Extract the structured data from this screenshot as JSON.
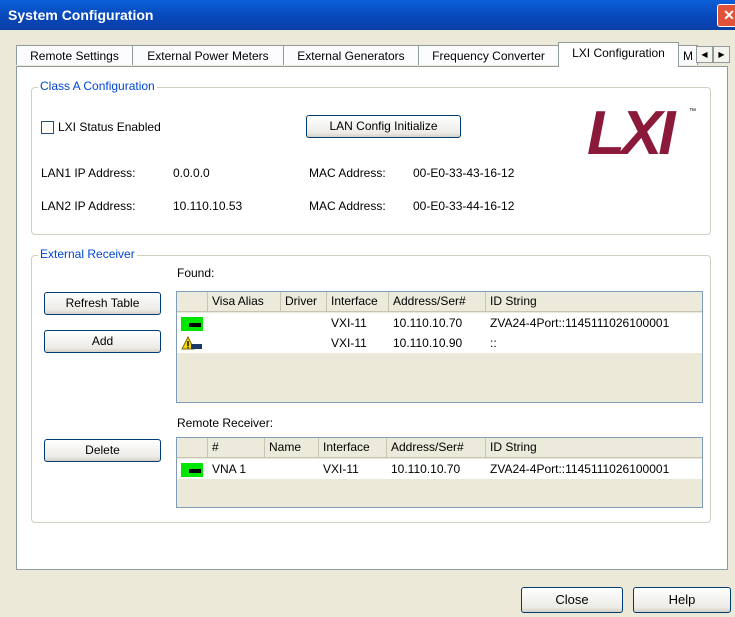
{
  "window": {
    "title": "System Configuration",
    "close_glyph": "✕"
  },
  "tabs": [
    {
      "label": "Remote Settings"
    },
    {
      "label": "External Power Meters"
    },
    {
      "label": "External Generators"
    },
    {
      "label": "Frequency Converter"
    },
    {
      "label": "LXI Configuration",
      "active": true
    },
    {
      "label": "M"
    }
  ],
  "tab_arrows": {
    "left": "◀",
    "right": "▶"
  },
  "class_a": {
    "title": "Class A Configuration",
    "lxi_status_label": "LXI Status Enabled",
    "lxi_status_checked": false,
    "lan_init_button": "LAN Config Initialize",
    "logo_text": "LXI",
    "logo_tm": "™",
    "lan1": {
      "label": "LAN1  IP Address:",
      "ip": "0.0.0.0",
      "mac_label": "MAC Address:",
      "mac": "00-E0-33-43-16-12"
    },
    "lan2": {
      "label": "LAN2  IP Address:",
      "ip": "10.110.10.53",
      "mac_label": "MAC Address:",
      "mac": "00-E0-33-44-16-12"
    }
  },
  "external_receiver": {
    "title": "External Receiver",
    "found_label": "Found:",
    "refresh_button": "Refresh Table",
    "add_button": "Add",
    "delete_button": "Delete",
    "found_table": {
      "columns": [
        "",
        "Visa Alias",
        "Driver",
        "Interface",
        "Address/Ser#",
        "ID String"
      ],
      "rows": [
        {
          "status": "ok",
          "visa_alias": "",
          "driver": "",
          "interface": "VXI-11",
          "address": "10.110.10.70",
          "id_string": "ZVA24-4Port::1145111026100001"
        },
        {
          "status": "warning",
          "visa_alias": "",
          "driver": "",
          "interface": "VXI-11",
          "address": "10.110.10.90",
          "id_string": "::"
        }
      ]
    },
    "remote_label": "Remote Receiver:",
    "remote_table": {
      "columns": [
        "",
        "#",
        "Name",
        "Interface",
        "Address/Ser#",
        "ID String"
      ],
      "rows": [
        {
          "status": "ok",
          "number": "VNA 1",
          "name": "",
          "interface": "VXI-11",
          "address": "10.110.10.70",
          "id_string": "ZVA24-4Port::1145111026100001"
        }
      ]
    }
  },
  "footer": {
    "close_button": "Close",
    "help_button": "Help"
  },
  "colors": {
    "title_bar": "#0a5fd8",
    "group_title": "#0046d5",
    "logo": "#8b1a3a",
    "status_ok": "#00e600",
    "status_warning": "#f5d800"
  }
}
